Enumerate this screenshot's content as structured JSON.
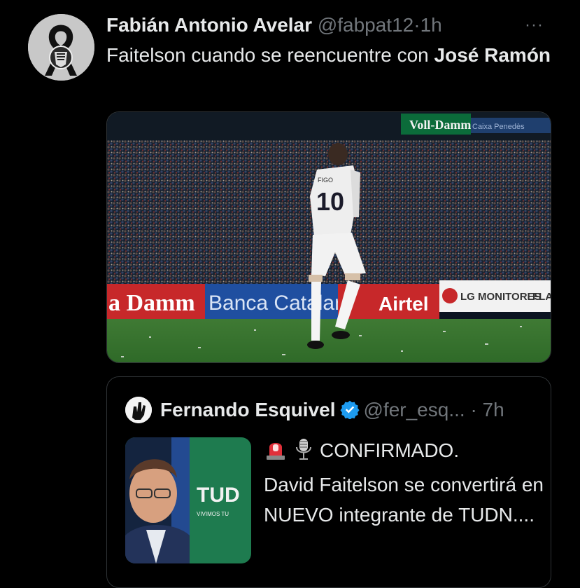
{
  "tweet": {
    "author_name": "Fabián Antonio Avelar",
    "author_handle": "@fabpat12",
    "separator": "·",
    "time": "1h",
    "more": "···",
    "text_plain": "Faitelson cuando se reencuentre con ",
    "text_bold": "José Ramón",
    "media": {
      "banner_vollDamm": "Voll-Damm",
      "banner_caixa": "Caixa Penedès",
      "ad_damm": "a Damm",
      "ad_banca": "Banca Catalana",
      "ad_airtel": "Airtel",
      "ad_lg": "LG MONITORES",
      "ad_flat": "FLA",
      "shirt_number": "10",
      "shirt_name": "FIGO"
    }
  },
  "quote": {
    "author_name": "Fernando Esquivel",
    "author_handle": "@fer_esq...",
    "separator": "·",
    "time": "7h",
    "line1": "CONFIRMADO.",
    "line2": "David Faitelson se convertirá en NUEVO integrante de TUDN....",
    "thumb_brand": "TUD",
    "thumb_tagline": "VIVIMOS TU",
    "colors": {
      "verified": "#1d9bf0",
      "tudn_green": "#1f7a4d"
    }
  }
}
